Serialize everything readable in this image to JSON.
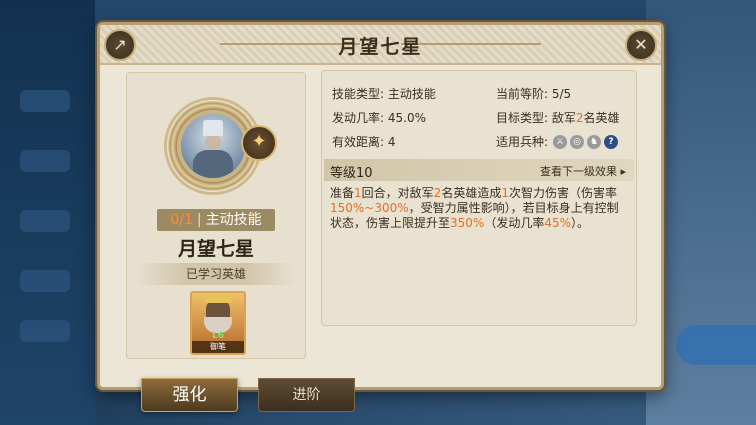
{
  "dialog": {
    "title": "月望七星"
  },
  "skill": {
    "count": "0/1",
    "separator": "|",
    "type_tag": "主动技能",
    "name": "月望七星",
    "learned_label": "已学习英雄",
    "hero_level": "L6",
    "hero_name": "御笔"
  },
  "attributes": {
    "skill_type": "技能类型: 主动技能",
    "current_level": "当前等阶: 5/5",
    "trigger_rate": "发动几率: 45.0%",
    "target_prefix": "目标类型: 敌军",
    "target_num": "2",
    "target_suffix": "名英雄",
    "range": "有效距离: 4",
    "troop_types": "适用兵种:"
  },
  "level": {
    "label": "等级10",
    "next_link": "查看下一级效果 ▸"
  },
  "description": {
    "p1": "准备",
    "n1": "1",
    "p2": "回合，对敌军",
    "n2": "2",
    "p3": "名英雄造成",
    "n3": "1",
    "p4": "次智力伤害（伤害率",
    "n4": "150%~300%",
    "p5": "，受智力属性影响），若目标身上有控制状态，伤害上限提升至",
    "n5": "350%",
    "p6": "（发动几率",
    "n6": "45%",
    "p7": "）。"
  },
  "tabs": {
    "strengthen": "强化",
    "advance": "进阶"
  },
  "icons": {
    "share": "share-icon",
    "close": "close-icon",
    "star": "star-icon",
    "troop_question": "?"
  },
  "colors": {
    "highlight": "#e0702a",
    "panel": "#ece6d6"
  }
}
